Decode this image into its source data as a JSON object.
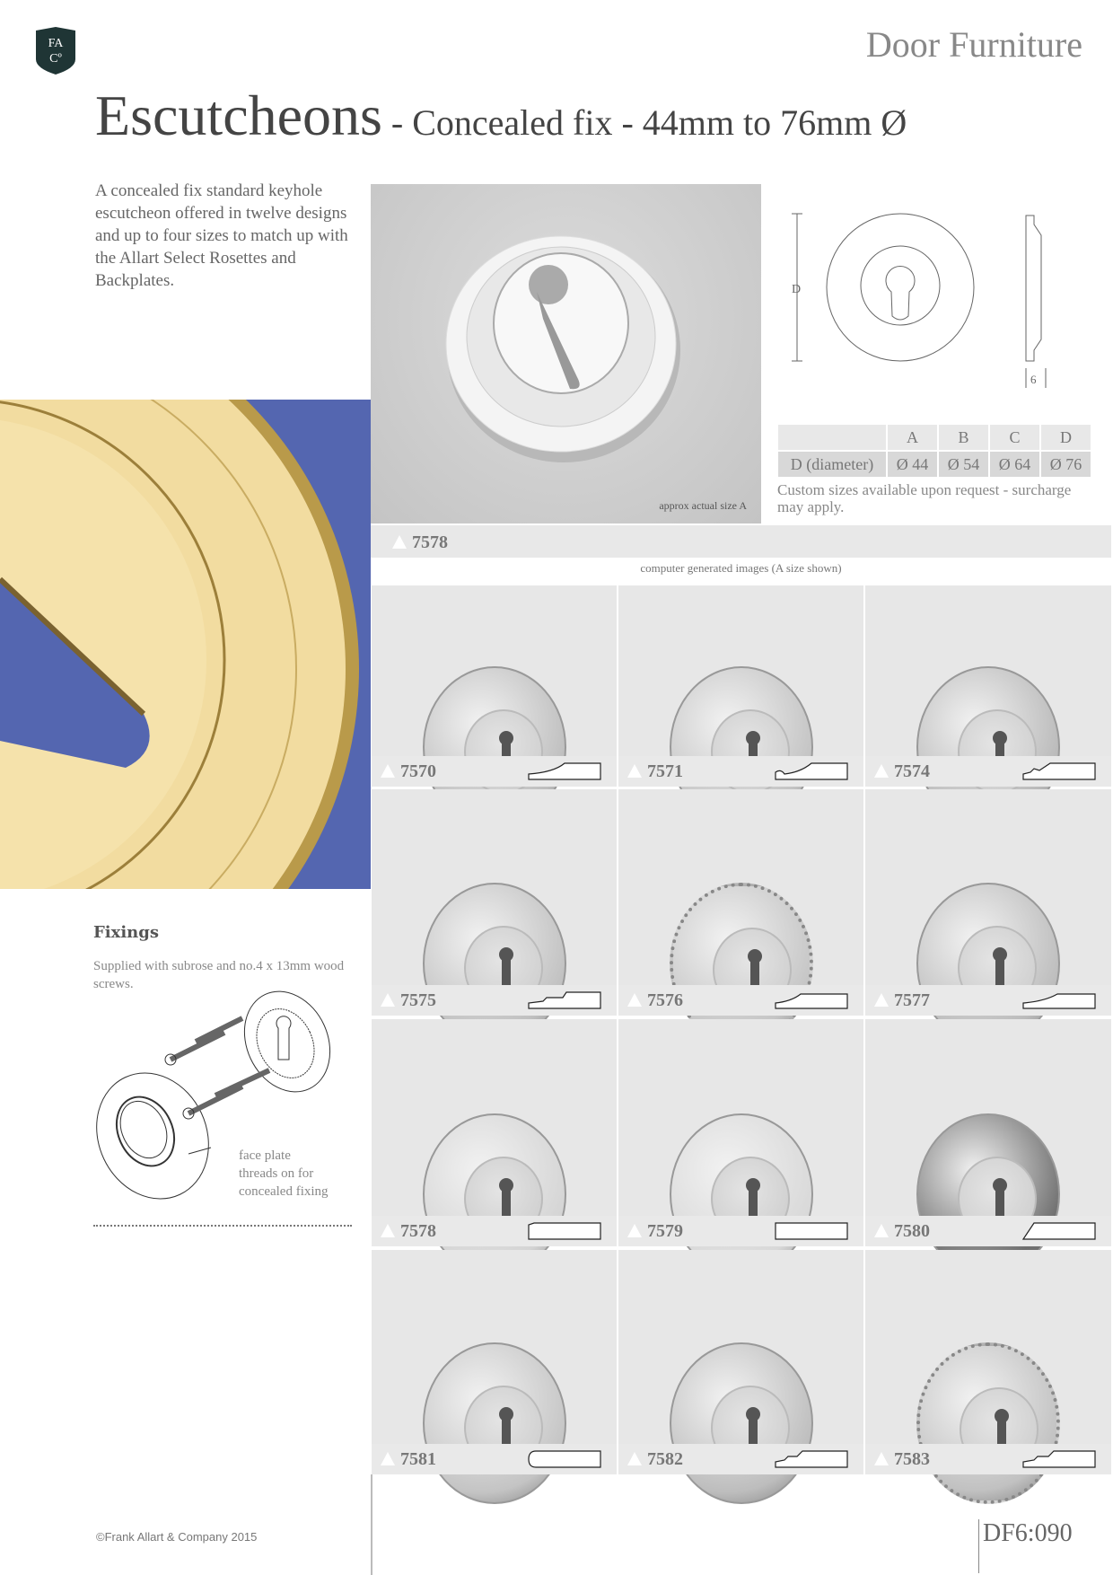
{
  "header": {
    "logo_text": [
      "FA",
      "Cº"
    ],
    "section": "Door Furniture",
    "title_main": "Escutcheons",
    "title_sub": " - Concealed fix - 44mm to 76mm Ø"
  },
  "intro": "A concealed fix standard keyhole escutcheon offered in twelve designs and up to four sizes to match up with the Allart Select Rosettes and Backplates.",
  "hero": {
    "caption": "approx actual size A"
  },
  "drawing": {
    "dim_d": "D",
    "dim_depth": "6"
  },
  "sizes": {
    "headers": [
      "",
      "A",
      "B",
      "C",
      "D"
    ],
    "row": [
      "D (diameter)",
      "Ø 44",
      "Ø 54",
      "Ø 64",
      "Ø 76"
    ],
    "note": "Custom sizes available upon request - surcharge may apply."
  },
  "featured": "7578",
  "cgi_caption": "computer generated images (A size shown)",
  "products": [
    {
      "code": "7570",
      "style": "plain-domed"
    },
    {
      "code": "7571",
      "style": "reeded-edge"
    },
    {
      "code": "7574",
      "style": "stepped-rings"
    },
    {
      "code": "7575",
      "style": "double-ring"
    },
    {
      "code": "7576",
      "style": "beaded"
    },
    {
      "code": "7577",
      "style": "domed"
    },
    {
      "code": "7578",
      "style": "stepped"
    },
    {
      "code": "7579",
      "style": "flat"
    },
    {
      "code": "7580",
      "style": "bevel"
    },
    {
      "code": "7581",
      "style": "rounded"
    },
    {
      "code": "7582",
      "style": "multi-ring"
    },
    {
      "code": "7583",
      "style": "beaded-ring"
    }
  ],
  "fixings": {
    "heading": "Fixings",
    "text": "Supplied with subrose and no.4 x 13mm wood screws.",
    "callout": [
      "face plate",
      "threads on for",
      "concealed fixing"
    ]
  },
  "footer": {
    "copyright": "©Frank Allart & Company 2015",
    "page": "DF6:090"
  },
  "colors": {
    "brass_bg": "#5466b0",
    "brass": "#f0d58f"
  }
}
